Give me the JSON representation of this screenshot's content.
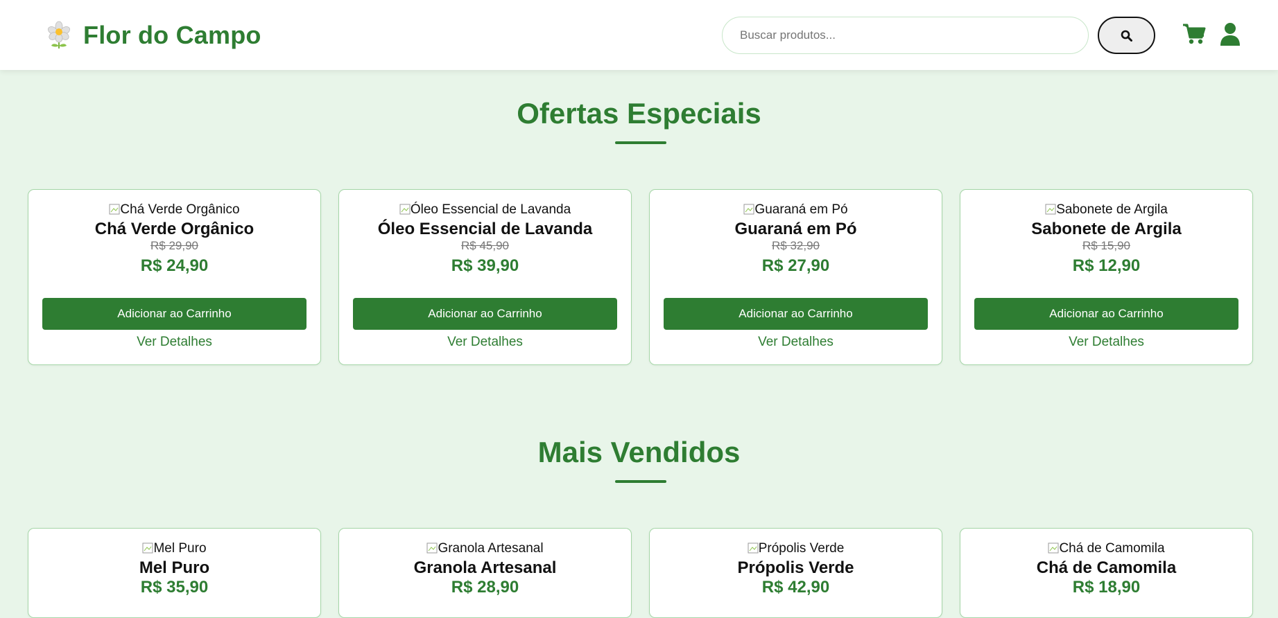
{
  "colors": {
    "brand": "#2e7d32",
    "background": "#e8f5e9",
    "card_border": "#a5d6a7"
  },
  "header": {
    "logo_icon": "flower-icon",
    "store_name": "Flor do Campo",
    "search": {
      "placeholder": "Buscar produtos...",
      "value": ""
    },
    "search_button_icon": "search-icon",
    "cart_icon": "cart-icon",
    "user_icon": "user-icon"
  },
  "sections": [
    {
      "title": "Ofertas Especiais",
      "products": [
        {
          "image_alt": "Chá Verde Orgânico",
          "name": "Chá Verde Orgânico",
          "old_price": "R$ 29,90",
          "price": "R$ 24,90",
          "add_label": "Adicionar ao Carrinho",
          "details_label": "Ver Detalhes"
        },
        {
          "image_alt": "Óleo Essencial de Lavanda",
          "name": "Óleo Essencial de Lavanda",
          "old_price": "R$ 45,90",
          "price": "R$ 39,90",
          "add_label": "Adicionar ao Carrinho",
          "details_label": "Ver Detalhes"
        },
        {
          "image_alt": "Guaraná em Pó",
          "name": "Guaraná em Pó",
          "old_price": "R$ 32,90",
          "price": "R$ 27,90",
          "add_label": "Adicionar ao Carrinho",
          "details_label": "Ver Detalhes"
        },
        {
          "image_alt": "Sabonete de Argila",
          "name": "Sabonete de Argila",
          "old_price": "R$ 15,90",
          "price": "R$ 12,90",
          "add_label": "Adicionar ao Carrinho",
          "details_label": "Ver Detalhes"
        }
      ]
    },
    {
      "title": "Mais Vendidos",
      "products": [
        {
          "image_alt": "Mel Puro",
          "name": "Mel Puro",
          "price": "R$ 35,90"
        },
        {
          "image_alt": "Granola Artesanal",
          "name": "Granola Artesanal",
          "price": "R$ 28,90"
        },
        {
          "image_alt": "Própolis Verde",
          "name": "Própolis Verde",
          "price": "R$ 42,90"
        },
        {
          "image_alt": "Chá de Camomila",
          "name": "Chá de Camomila",
          "price": "R$ 18,90"
        }
      ]
    }
  ]
}
